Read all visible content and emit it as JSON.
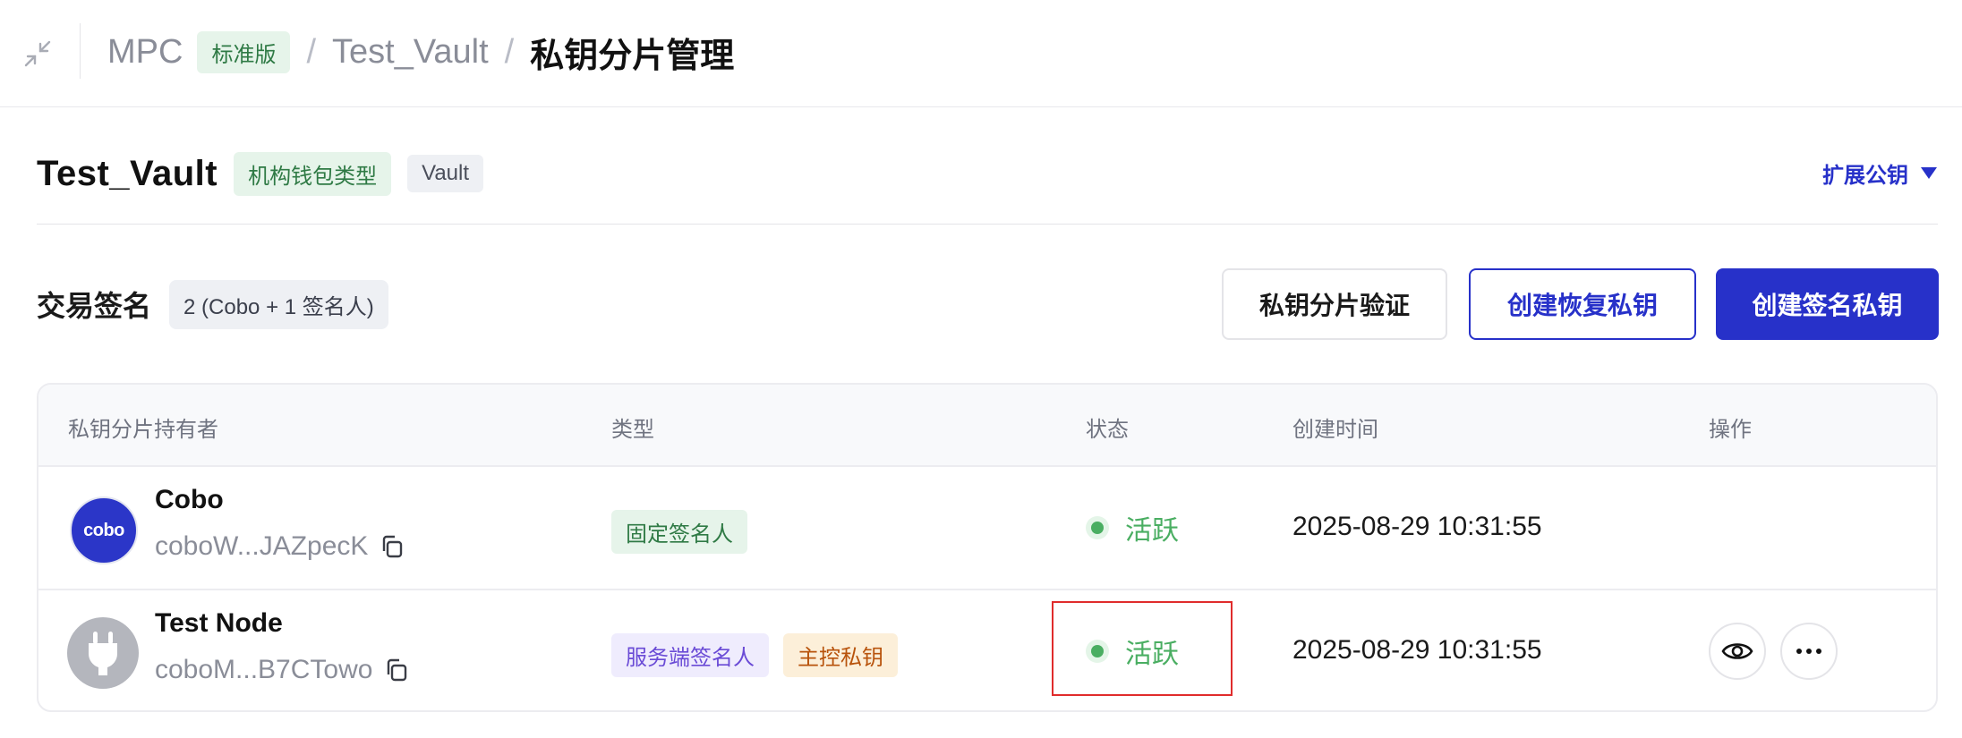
{
  "breadcrumb": {
    "root": "MPC",
    "edition_badge": "标准版",
    "separator": "/",
    "vault": "Test_Vault",
    "current": "私钥分片管理"
  },
  "vault": {
    "title": "Test_Vault",
    "tags": [
      "机构钱包类型",
      "Vault"
    ],
    "expand_label": "扩展公钥"
  },
  "signing": {
    "title": "交易签名",
    "count_tag": "2 (Cobo + 1 签名人)"
  },
  "actions": {
    "verify_label": "私钥分片验证",
    "recover_label": "创建恢复私钥",
    "create_label": "创建签名私钥"
  },
  "table": {
    "headers": [
      "私钥分片持有者",
      "类型",
      "状态",
      "创建时间",
      "操作"
    ],
    "rows": [
      {
        "name": "Cobo",
        "address": "coboW...JAZpecK",
        "types": [
          "固定签名人"
        ],
        "status": "活跃",
        "created": "2025-08-29 10:31:55",
        "avatar_text": "cobo"
      },
      {
        "name": "Test Node",
        "address": "coboM...B7CTowo",
        "types": [
          "服务端签名人",
          "主控私钥"
        ],
        "status": "活跃",
        "created": "2025-08-29 10:31:55"
      }
    ]
  },
  "colors": {
    "primary": "#2731c9",
    "active_green": "#4aae62",
    "highlight_red": "#e02c2c"
  },
  "icons": [
    "collapse-icon",
    "caret-down-icon",
    "copy-icon",
    "eye-icon",
    "more-icon",
    "plug-icon"
  ]
}
